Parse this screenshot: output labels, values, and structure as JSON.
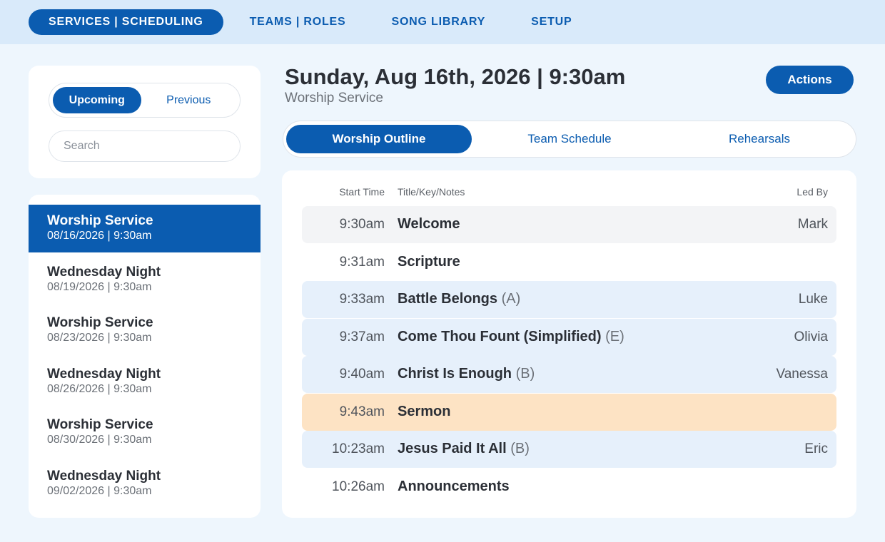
{
  "nav": {
    "items": [
      {
        "label": "SERVICES | SCHEDULING",
        "active": true
      },
      {
        "label": "TEAMS | ROLES",
        "active": false
      },
      {
        "label": "SONG LIBRARY",
        "active": false
      },
      {
        "label": "SETUP",
        "active": false
      }
    ]
  },
  "filter": {
    "upcoming": "Upcoming",
    "previous": "Previous",
    "search_placeholder": "Search"
  },
  "services": [
    {
      "name": "Worship Service",
      "date": "08/16/2026 | 9:30am",
      "active": true
    },
    {
      "name": "Wednesday Night",
      "date": "08/19/2026 | 9:30am",
      "active": false
    },
    {
      "name": "Worship Service",
      "date": "08/23/2026 | 9:30am",
      "active": false
    },
    {
      "name": "Wednesday Night",
      "date": "08/26/2026 | 9:30am",
      "active": false
    },
    {
      "name": "Worship Service",
      "date": "08/30/2026 | 9:30am",
      "active": false
    },
    {
      "name": "Wednesday Night",
      "date": "09/02/2026 | 9:30am",
      "active": false
    }
  ],
  "header": {
    "title": "Sunday, Aug 16th, 2026 | 9:30am",
    "subtitle": "Worship Service",
    "actions_label": "Actions"
  },
  "tabs": [
    {
      "label": "Worship Outline",
      "active": true
    },
    {
      "label": "Team Schedule",
      "active": false
    },
    {
      "label": "Rehearsals",
      "active": false
    }
  ],
  "outline": {
    "columns": {
      "start_time": "Start Time",
      "title": "Title/Key/Notes",
      "led_by": "Led By"
    },
    "rows": [
      {
        "time": "9:30am",
        "title": "Welcome",
        "key": "",
        "led_by": "Mark",
        "style": "gray"
      },
      {
        "time": "9:31am",
        "title": "Scripture",
        "key": "",
        "led_by": "",
        "style": "none"
      },
      {
        "time": "9:33am",
        "title": "Battle Belongs",
        "key": "(A)",
        "led_by": "Luke",
        "style": "blue"
      },
      {
        "time": "9:37am",
        "title": "Come Thou Fount (Simplified)",
        "key": "(E)",
        "led_by": "Olivia",
        "style": "blue"
      },
      {
        "time": "9:40am",
        "title": "Christ Is Enough",
        "key": "(B)",
        "led_by": "Vanessa",
        "style": "blue"
      },
      {
        "time": "9:43am",
        "title": "Sermon",
        "key": "",
        "led_by": "",
        "style": "orange"
      },
      {
        "time": "10:23am",
        "title": "Jesus Paid It All",
        "key": "(B)",
        "led_by": "Eric",
        "style": "blue"
      },
      {
        "time": "10:26am",
        "title": "Announcements",
        "key": "",
        "led_by": "",
        "style": "none"
      }
    ]
  },
  "colors": {
    "accent": "#0b5cb0",
    "nav_bg": "#d9eafa",
    "page_bg": "#eef6fd",
    "song_row": "#e6f0fb",
    "sermon_row": "#fde3c4",
    "welcome_row": "#f3f4f6"
  }
}
